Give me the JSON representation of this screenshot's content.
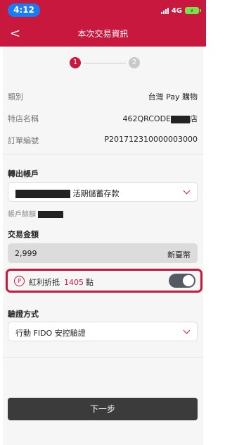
{
  "status_bar": {
    "time": "4:12",
    "network": "4G"
  },
  "nav": {
    "back": "<",
    "title": "本次交易資訊"
  },
  "steps": [
    "1",
    "2"
  ],
  "details": [
    {
      "label": "類別",
      "value": "台灣 Pay 購物"
    },
    {
      "label": "特店名稱",
      "value_prefix": "462QRCODE",
      "value_suffix": "店"
    },
    {
      "label": "訂單編號",
      "value": "P201712310000003000"
    }
  ],
  "transfer": {
    "label": "轉出帳戶",
    "account_type": "活期儲蓄存款",
    "balance_label": "帳戶餘額"
  },
  "amount": {
    "label": "交易金額",
    "value": "2,999",
    "currency": "新臺幣"
  },
  "bonus": {
    "icon_text": "P",
    "label": "紅利折抵",
    "points": "1405",
    "unit": "點",
    "toggle_on": true
  },
  "verify": {
    "label": "驗證方式",
    "method": "行動 FIDO 安控驗證"
  },
  "next_button": "下一步",
  "colors": {
    "brand": "#c8183d",
    "button": "#3b3b3b"
  }
}
